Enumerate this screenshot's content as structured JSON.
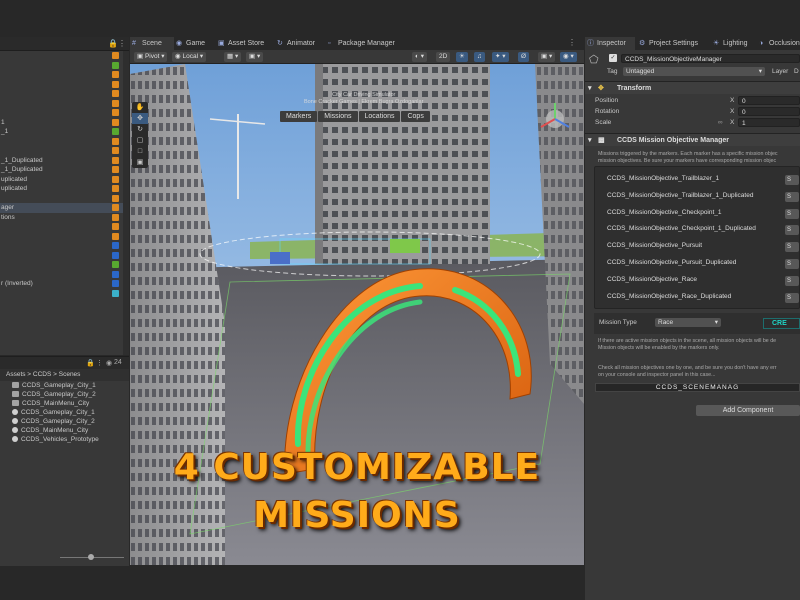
{
  "hierarchy": {
    "rows": [
      {
        "label": "",
        "tag": "o"
      },
      {
        "label": "",
        "tag": "g"
      },
      {
        "label": "",
        "tag": "o"
      },
      {
        "label": "",
        "tag": "o"
      },
      {
        "label": "",
        "tag": "o"
      },
      {
        "label": "",
        "tag": "o"
      },
      {
        "label": "",
        "tag": "o"
      },
      {
        "label": "1",
        "tag": "o"
      },
      {
        "label": "_1",
        "tag": "g"
      },
      {
        "label": "",
        "tag": "o"
      },
      {
        "label": "",
        "tag": "o"
      },
      {
        "label": "_1_Duplicated",
        "tag": "o"
      },
      {
        "label": "_1_Duplicated",
        "tag": "o"
      },
      {
        "label": "uplicated",
        "tag": "o"
      },
      {
        "label": "uplicated",
        "tag": "o"
      },
      {
        "label": "",
        "tag": "o"
      },
      {
        "label": "ager",
        "tag": "o",
        "selected": true
      },
      {
        "label": "tions",
        "tag": "o"
      },
      {
        "label": "",
        "tag": "o"
      },
      {
        "label": "",
        "tag": "o"
      },
      {
        "label": "",
        "tag": "b"
      },
      {
        "label": "",
        "tag": "b"
      },
      {
        "label": "",
        "tag": "g"
      },
      {
        "label": "",
        "tag": "b"
      },
      {
        "label": "r (Inverted)",
        "tag": "b"
      },
      {
        "label": "",
        "tag": "c"
      }
    ]
  },
  "project": {
    "count": "24",
    "breadcrumb": "Assets > CCDS > Scenes",
    "items": [
      {
        "label": "CCDS_Gameplay_City_1",
        "type": "folder"
      },
      {
        "label": "CCDS_Gameplay_City_2",
        "type": "folder"
      },
      {
        "label": "CCDS_MainMenu_City",
        "type": "folder"
      },
      {
        "label": "CCDS_Gameplay_City_1",
        "type": "unity"
      },
      {
        "label": "CCDS_Gameplay_City_2",
        "type": "unity"
      },
      {
        "label": "CCDS_MainMenu_City",
        "type": "unity"
      },
      {
        "label": "CCDS_Vehicles_Prototype",
        "type": "unity"
      }
    ]
  },
  "scene": {
    "tabs": [
      "Scene",
      "Game",
      "Asset Store",
      "Animator",
      "Package Manager"
    ],
    "toolbar": {
      "pivot": "Pivot",
      "local": "Local",
      "mode2d": "2D"
    },
    "overlay_menu": [
      "Markers",
      "Missions",
      "Locations",
      "Cops"
    ],
    "caption_line1": "City Car Driving Simulator",
    "caption_line2": "Bone Cracker Games | Ekrem Bugra Ozdoganlar",
    "promo_line1": "4 CUSTOMIZABLE",
    "promo_line2": "MISSIONS"
  },
  "inspector": {
    "tabs": [
      "Inspector",
      "Project Settings",
      "Lighting",
      "Occlusion"
    ],
    "object_name": "CCDS_MissionObjectiveManager",
    "tag_label": "Tag",
    "tag_value": "Untagged",
    "layer_label": "Layer",
    "layer_value": "D",
    "transform": {
      "title": "Transform",
      "position_label": "Position",
      "rotation_label": "Rotation",
      "scale_label": "Scale",
      "axis_x": "X",
      "position_x": "0",
      "rotation_x": "0",
      "scale_x": "1"
    },
    "manager": {
      "title": "CCDS Mission Objective Manager",
      "description_line1": "Missions triggered by the markers. Each marker has a specific mission objec",
      "description_line2": "mission objectives. Be sure your markers have corresponding mission objec",
      "objectives": [
        "CCDS_MissionObjective_Trailblazer_1",
        "CCDS_MissionObjective_Trailblazer_1_Duplicated",
        "CCDS_MissionObjective_Checkpoint_1",
        "CCDS_MissionObjective_Checkpoint_1_Duplicated",
        "CCDS_MissionObjective_Pursuit",
        "CCDS_MissionObjective_Pursuit_Duplicated",
        "CCDS_MissionObjective_Race",
        "CCDS_MissionObjective_Race_Duplicated"
      ],
      "select_short": "S",
      "mission_type_label": "Mission Type",
      "mission_type_value": "Race",
      "create_label": "CRE",
      "note1_line1": "If there are active mission objects in the scene, all mission objects will be de",
      "note1_line2": "Mission objects will be enabled by the markers only.",
      "note2_line1": "Check all mission objectives one by one, and be sure you don't have any err",
      "note2_line2": "on your console and inspector panel in this case...",
      "scene_manager_label": "CCDS_SCENEMANAG"
    },
    "add_component": "Add Component"
  },
  "colors": {
    "accent": "#3a5a80",
    "promo_text": "#ffab1a",
    "arch": "#f07a22",
    "arch_stripes": "#33e07a",
    "create_teal": "#1fd4c5"
  }
}
